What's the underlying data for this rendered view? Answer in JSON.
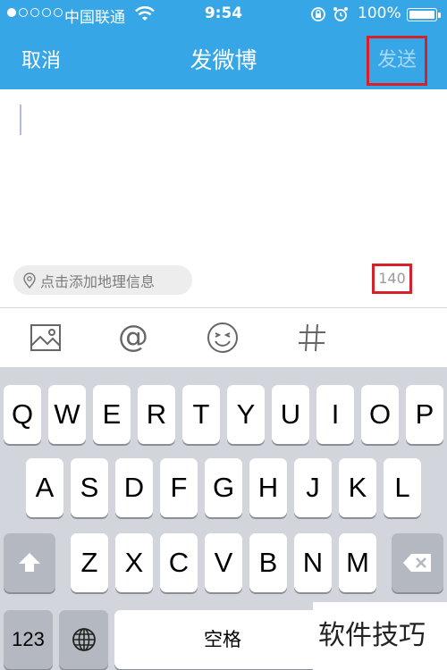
{
  "status_bar": {
    "carrier": "中国联通",
    "time": "9:54",
    "battery": "100%",
    "signal_bars_filled": 1,
    "signal_bars_total": 5
  },
  "nav": {
    "cancel_label": "取消",
    "title": "发微博",
    "send_label": "发送"
  },
  "compose": {
    "location_label": "点击添加地理信息",
    "char_count": "140"
  },
  "toolbar": {
    "icons": [
      "image-icon",
      "at-icon",
      "emoji-icon",
      "hashtag-icon"
    ],
    "at_glyph": "@",
    "hash_glyph": "#"
  },
  "keyboard": {
    "row1": [
      "Q",
      "W",
      "E",
      "R",
      "T",
      "Y",
      "U",
      "I",
      "O",
      "P"
    ],
    "row2": [
      "A",
      "S",
      "D",
      "F",
      "G",
      "H",
      "J",
      "K",
      "L"
    ],
    "row3": [
      "Z",
      "X",
      "C",
      "V",
      "B",
      "N",
      "M"
    ],
    "numbers_label": "123",
    "space_label": "空格"
  },
  "watermark": "软件技巧",
  "colors": {
    "header": "#36a6e6",
    "highlight_box": "#d7202a",
    "keyboard_bg": "#d2d5db"
  }
}
